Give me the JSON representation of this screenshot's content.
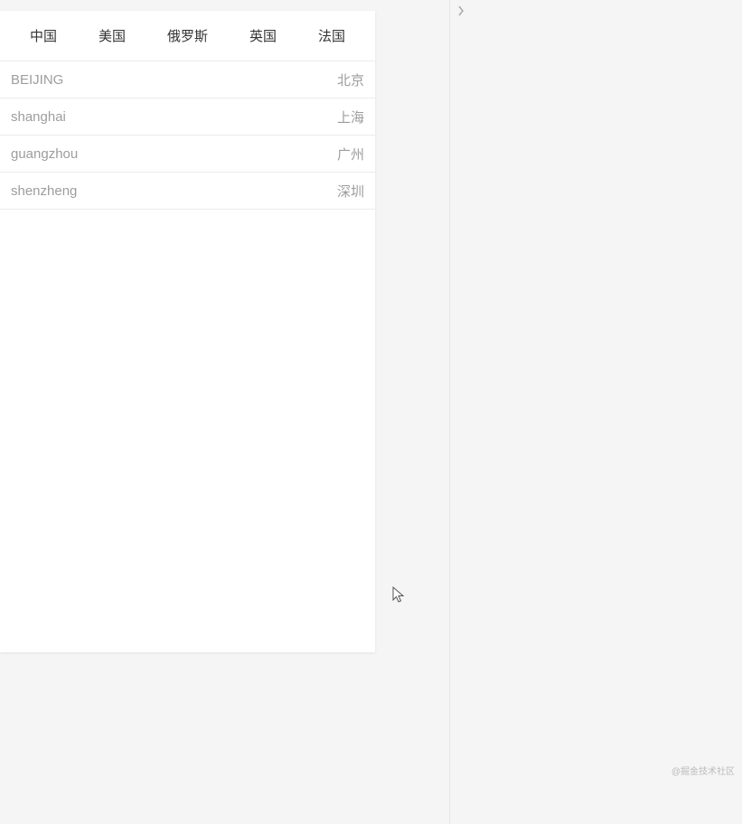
{
  "tabs": [
    {
      "label": "中国"
    },
    {
      "label": "美国"
    },
    {
      "label": "俄罗斯"
    },
    {
      "label": "英国"
    },
    {
      "label": "法国"
    }
  ],
  "cities": [
    {
      "en": "BEIJING",
      "cn": "北京"
    },
    {
      "en": "shanghai",
      "cn": "上海"
    },
    {
      "en": "guangzhou",
      "cn": "广州"
    },
    {
      "en": "shenzheng",
      "cn": "深圳"
    }
  ],
  "watermark": "@掘金技术社区"
}
